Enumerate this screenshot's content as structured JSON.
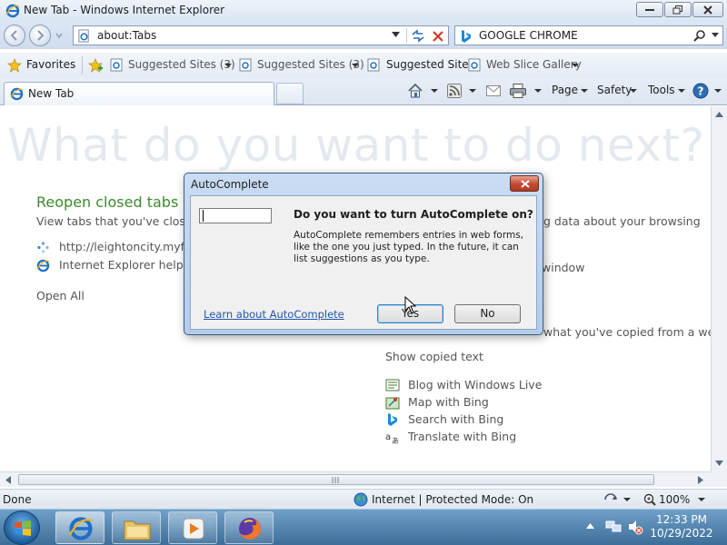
{
  "window": {
    "title": "New Tab - Windows Internet Explorer"
  },
  "address": {
    "url": "about:Tabs"
  },
  "search": {
    "value": "GOOGLE CHROME"
  },
  "favorites_bar": {
    "favorites_label": "Favorites",
    "items": [
      {
        "label": "Suggested Sites (3)"
      },
      {
        "label": "Suggested Sites (3)"
      },
      {
        "label": "Suggested Sites"
      },
      {
        "label": "Web Slice Gallery"
      }
    ]
  },
  "tabs": {
    "active_label": "New Tab"
  },
  "command_bar": {
    "page": "Page",
    "safety": "Safety",
    "tools": "Tools"
  },
  "newtab": {
    "hero": "What do you want to do next?",
    "reopen_title": "Reopen closed tabs",
    "reopen_desc": "View tabs that you've closed",
    "reopen_links": [
      {
        "label": "http://leightoncity.myftp"
      },
      {
        "label": "Internet Explorer help"
      }
    ],
    "open_all": "Open All",
    "partial_browsing": "g data about your browsing",
    "partial_window": "window",
    "partial_copied": "what you've copied from a webp",
    "show_copied": "Show copied text",
    "actions": [
      {
        "label": "Blog with Windows Live"
      },
      {
        "label": "Map with Bing"
      },
      {
        "label": "Search with Bing"
      },
      {
        "label": "Translate with Bing"
      }
    ]
  },
  "status": {
    "left": "Done",
    "zone": "Internet | Protected Mode: On",
    "zoom": "100%"
  },
  "taskbar": {
    "time": "12:33 PM",
    "date": "10/29/2022"
  },
  "dialog": {
    "title": "AutoComplete",
    "question": "Do you want to turn AutoComplete on?",
    "description": "AutoComplete remembers entries in web forms, like the one you just typed. In the future, it can list suggestions as you type.",
    "learn_link": "Learn about AutoComplete",
    "yes_label": "Yes",
    "no_label": "No"
  },
  "colors": {
    "accent_green": "#3c8a2e",
    "link_blue": "#2155b3",
    "close_red": "#c24a33"
  }
}
